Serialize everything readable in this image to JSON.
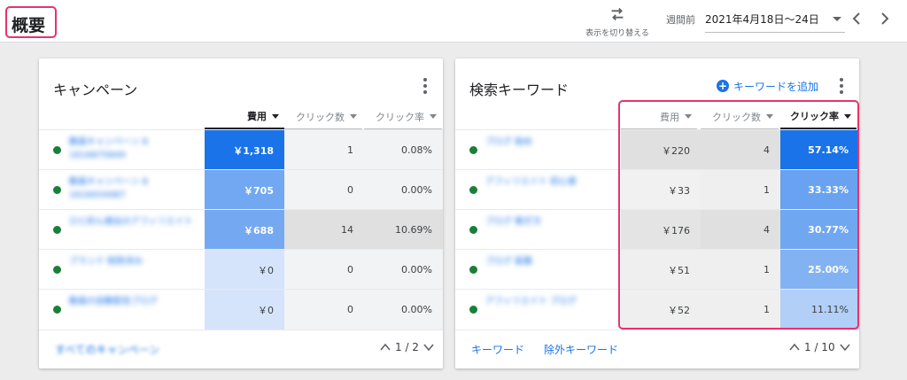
{
  "header": {
    "title": "概要",
    "switch_label": "表示を切り替える",
    "period_prefix": "週間前",
    "date_range": "2021年4月18日〜24日"
  },
  "campaign_card": {
    "title": "キャンペーン",
    "columns": [
      "費用",
      "クリック数",
      "クリック率"
    ],
    "rows": [
      {
        "name": "動画キャンペーン 8 1616875849",
        "cost": "￥1,318",
        "clicks": "1",
        "ctr": "0.08%",
        "cost_level": 1.0
      },
      {
        "name": "動画キャンペーン 8 1616934987",
        "cost": "￥705",
        "clicks": "0",
        "ctr": "0.00%",
        "cost_level": 0.53
      },
      {
        "name": "ひと好ん検出のアフィリエイト",
        "cost": "￥688",
        "clicks": "14",
        "ctr": "10.69%",
        "cost_level": 0.52
      },
      {
        "name": "ブランド 削除済み",
        "cost": "￥0",
        "clicks": "0",
        "ctr": "0.00%",
        "cost_level": 0.0
      },
      {
        "name": "動画の自動配信ブログ",
        "cost": "￥0",
        "clicks": "0",
        "ctr": "0.00%",
        "cost_level": 0.0
      }
    ],
    "footer_link": "すべてのキャンペーン",
    "pager": "1 / 2"
  },
  "keyword_card": {
    "title": "検索キーワード",
    "add_label": "キーワードを追加",
    "columns": [
      "費用",
      "クリック数",
      "クリック率"
    ],
    "rows": [
      {
        "name": "ブログ 始め",
        "cost": "￥220",
        "clicks": "4",
        "ctr": "57.14%",
        "ctr_level": 1.0
      },
      {
        "name": "アフィリエイト 初心者",
        "cost": "￥33",
        "clicks": "1",
        "ctr": "33.33%",
        "ctr_level": 0.58
      },
      {
        "name": "ブログ 稼ぎ方",
        "cost": "￥176",
        "clicks": "4",
        "ctr": "30.77%",
        "ctr_level": 0.54
      },
      {
        "name": "ブログ 副業",
        "cost": "￥51",
        "clicks": "1",
        "ctr": "25.00%",
        "ctr_level": 0.44
      },
      {
        "name": "アフィリエイト ブログ",
        "cost": "￥52",
        "clicks": "1",
        "ctr": "11.11%",
        "ctr_level": 0.19
      }
    ],
    "footer_links": [
      "キーワード",
      "除外キーワード"
    ],
    "pager": "1 / 10"
  },
  "colors": {
    "accent": "#1a73e8",
    "highlight_border": "#e8336b",
    "status_enabled": "#188038"
  }
}
